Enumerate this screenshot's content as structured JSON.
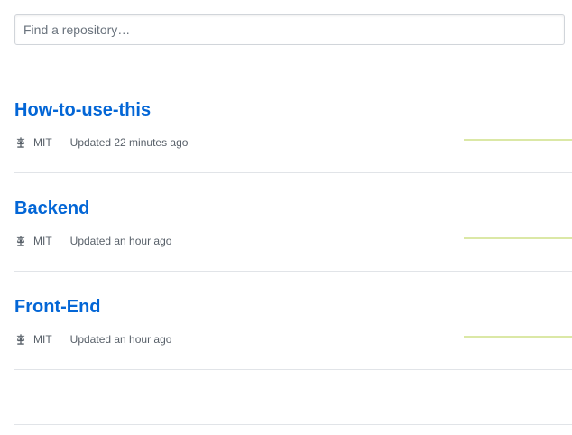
{
  "search": {
    "placeholder": "Find a repository…",
    "value": ""
  },
  "repositories": [
    {
      "name": "How-to-use-this",
      "license": "MIT",
      "updated": "Updated 22 minutes ago"
    },
    {
      "name": "Backend",
      "license": "MIT",
      "updated": "Updated an hour ago"
    },
    {
      "name": "Front-End",
      "license": "MIT",
      "updated": "Updated an hour ago"
    }
  ],
  "icons": {
    "license": "law-icon"
  },
  "colors": {
    "link": "#0366d6",
    "meta_text": "#586069",
    "activity": "#dbe8a6",
    "border": "#e1e4e8"
  }
}
